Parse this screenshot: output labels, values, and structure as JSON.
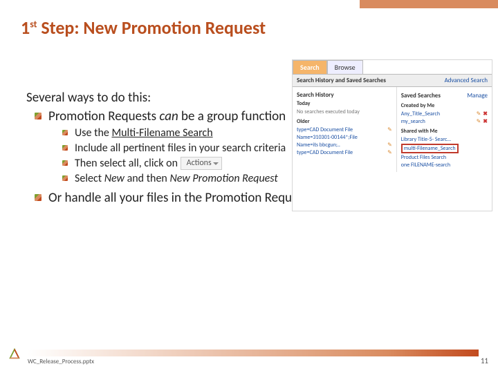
{
  "title_prefix": "1",
  "title_super": "st",
  "title_rest": " Step:   New Promotion Request",
  "lead": "Several ways to do this:",
  "lvl1_a_pre": "Promotion Requests ",
  "lvl1_a_ital": "can",
  "lvl1_a_post": " be a group function",
  "lvl2_a_pre": "Use the ",
  "lvl2_a_link": "Multi-Filename Search",
  "lvl2_b": "Include all pertinent files in your search criteria",
  "lvl2_c": "Then select all, click on ",
  "actions_label": "Actions",
  "lvl2_d_pre": "Select ",
  "lvl2_d_new": "New",
  "lvl2_d_mid": " and then ",
  "lvl2_d_npr": "New Promotion Request",
  "lvl1_b": "Or handle all your files in the Promotion Request window itself",
  "mock": {
    "tab_search": "Search",
    "tab_browse": "Browse",
    "bar_title": "Search History and Saved Searches",
    "adv": "Advanced Search",
    "sh": "Search History",
    "today": "Today",
    "today_msg": "No searches executed today",
    "older": "Older",
    "older_r1a": "type=CAD Document File",
    "older_r1b": "Name=310301-00144*;File",
    "older_r2": "Name=its bbcgun;..",
    "older_r3": "type=CAD Document  File",
    "ss": "Saved Searches",
    "manage": "Manage",
    "cbm": "Created by Me",
    "cbm_r1": "Any_Title_Search",
    "cbm_r2": "my_search",
    "swm": "Shared with Me",
    "swm_r1": "Library Title-5- Searc…",
    "swm_hl": "multi-Filename_Search",
    "swm_r3": "Product Files Search",
    "swm_r4": "one FILENAME-search"
  },
  "footer_file": "WC_Release_Process.pptx",
  "footer_page": "11"
}
